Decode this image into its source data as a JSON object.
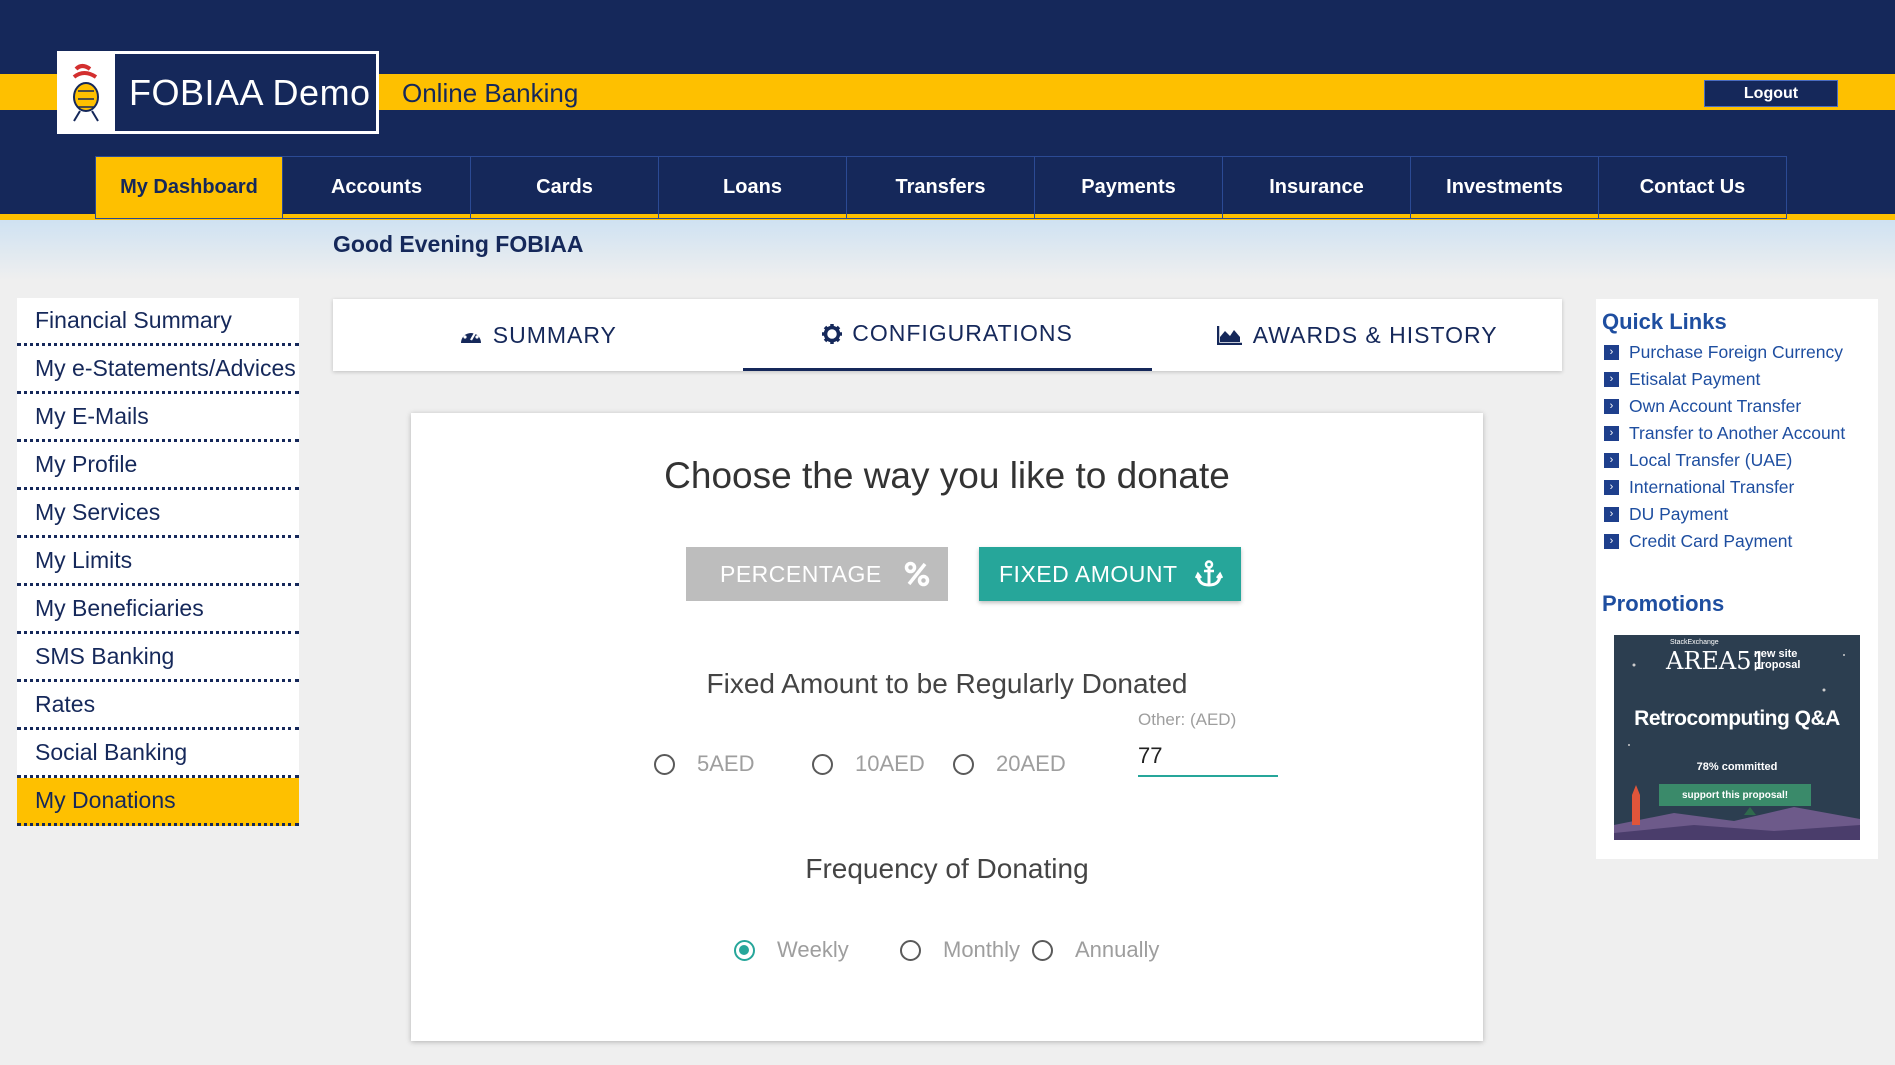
{
  "header": {
    "logo_text": "FOBIAA Demo",
    "subtitle": "Online Banking",
    "logout_label": "Logout"
  },
  "nav": [
    {
      "label": "My Dashboard",
      "active": true
    },
    {
      "label": "Accounts"
    },
    {
      "label": "Cards"
    },
    {
      "label": "Loans"
    },
    {
      "label": "Transfers"
    },
    {
      "label": "Payments"
    },
    {
      "label": "Insurance"
    },
    {
      "label": "Investments"
    },
    {
      "label": "Contact Us"
    }
  ],
  "greeting": "Good Evening FOBIAA",
  "left_menu": [
    {
      "label": "Financial Summary"
    },
    {
      "label": "My e-Statements/Advices"
    },
    {
      "label": "My E-Mails"
    },
    {
      "label": "My Profile"
    },
    {
      "label": "My Services"
    },
    {
      "label": "My Limits"
    },
    {
      "label": "My Beneficiaries"
    },
    {
      "label": "SMS Banking"
    },
    {
      "label": "Rates"
    },
    {
      "label": "Social Banking"
    },
    {
      "label": "My Donations",
      "active": true
    }
  ],
  "tabs": [
    {
      "label": "SUMMARY",
      "icon": "tachometer-icon"
    },
    {
      "label": "CONFIGURATIONS",
      "icon": "gear-icon",
      "active": true
    },
    {
      "label": "AWARDS & HISTORY",
      "icon": "area-chart-icon"
    }
  ],
  "donate": {
    "title": "Choose the way you like to donate",
    "percentage_label": "PERCENTAGE",
    "fixed_label": "FIXED AMOUNT",
    "selected_mode": "FIXED AMOUNT",
    "amount_heading": "Fixed Amount to be Regularly Donated",
    "amount_options": [
      "5AED",
      "10AED",
      "20AED"
    ],
    "other_label": "Other: (AED)",
    "other_value": "77",
    "frequency_heading": "Frequency of Donating",
    "frequency_options": [
      "Weekly",
      "Monthly",
      "Annually"
    ],
    "frequency_selected": "Weekly"
  },
  "quick_links": {
    "title": "Quick Links",
    "items": [
      "Purchase Foreign Currency",
      "Etisalat Payment",
      "Own Account Transfer",
      "Transfer to Another Account",
      "Local Transfer (UAE)",
      "International Transfer",
      "DU Payment",
      "Credit Card Payment"
    ]
  },
  "promotions": {
    "title": "Promotions",
    "brand_sup": "StackExchange",
    "brand": "AREA51",
    "tag": "new site proposal",
    "headline": "Retrocomputing Q&A",
    "committed": "78% committed",
    "cta": "support this proposal!"
  },
  "colors": {
    "navy": "#15285a",
    "yellow": "#fec000",
    "teal": "#26a69a",
    "link_blue": "#1e4ea0"
  }
}
